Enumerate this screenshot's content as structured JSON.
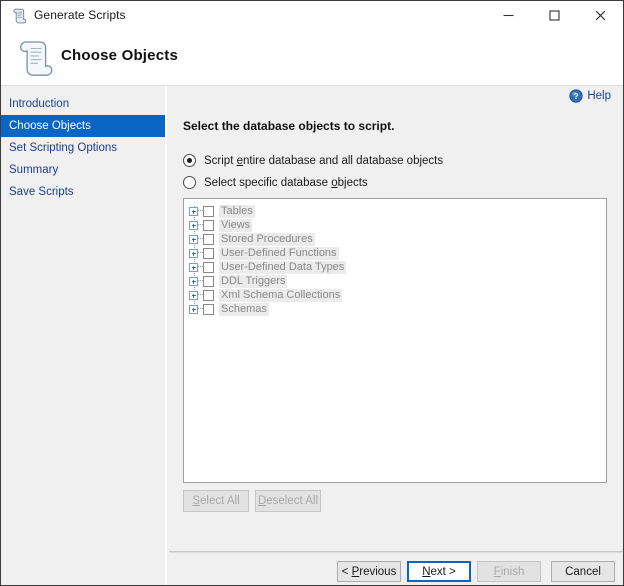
{
  "window": {
    "title": "Generate Scripts",
    "title_icon": "scroll-icon",
    "minimize_label": "─",
    "maximize_label": "□",
    "close_label": "✕"
  },
  "banner": {
    "title": "Choose Objects",
    "icon": "scroll-icon"
  },
  "sidebar": {
    "items": [
      {
        "label": "Introduction",
        "active": false
      },
      {
        "label": "Choose Objects",
        "active": true
      },
      {
        "label": "Set Scripting Options",
        "active": false
      },
      {
        "label": "Summary",
        "active": false
      },
      {
        "label": "Save Scripts",
        "active": false
      }
    ]
  },
  "content": {
    "help_label": "Help",
    "help_icon": "question-circle-icon",
    "prompt": "Select the database objects to script.",
    "radios": [
      {
        "pre": "Script ",
        "accel": "e",
        "post": "ntire database and all database objects",
        "selected": true
      },
      {
        "pre": "Select specific database ",
        "accel": "o",
        "post": "bjects",
        "selected": false
      }
    ],
    "tree_items": [
      "Tables",
      "Views",
      "Stored Procedures",
      "User-Defined Functions",
      "User-Defined Data Types",
      "DDL Triggers",
      "Xml Schema Collections",
      "Schemas"
    ],
    "select_all": {
      "pre": "",
      "accel": "S",
      "post": "elect All"
    },
    "deselect_all": {
      "pre": "",
      "accel": "D",
      "post": "eselect All"
    }
  },
  "footer": {
    "buttons": [
      {
        "pre": "< ",
        "accel": "P",
        "post": "revious",
        "state": "normal"
      },
      {
        "pre": "",
        "accel": "N",
        "post": "ext >",
        "state": "focused"
      },
      {
        "pre": "",
        "accel": "F",
        "post": "inish",
        "state": "disabled"
      },
      {
        "pre": "Cancel",
        "accel": "",
        "post": "",
        "state": "normal"
      }
    ]
  },
  "colors": {
    "accent": "#0a65c4",
    "link": "#1c3f94",
    "window_bg": "#f0f0f0",
    "panel_bg": "#ffffff",
    "disabled_text": "#a8a8a8"
  }
}
